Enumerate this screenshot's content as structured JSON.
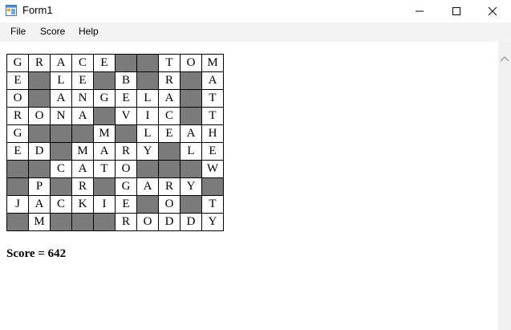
{
  "window": {
    "title": "Form1",
    "icons": {
      "app": "form-app-icon",
      "minimize": "minimize-icon",
      "maximize": "maximize-icon",
      "close": "close-icon",
      "scroll_up": "chevron-up-icon"
    }
  },
  "menu": [
    {
      "label": "File"
    },
    {
      "label": "Score"
    },
    {
      "label": "Help"
    }
  ],
  "grid": {
    "rows": [
      [
        "G",
        "R",
        "A",
        "C",
        "E",
        "#",
        "#",
        "T",
        "O",
        "M"
      ],
      [
        "E",
        "#",
        "L",
        "E",
        "#",
        "B",
        "#",
        "R",
        "#",
        "A"
      ],
      [
        "O",
        "#",
        "A",
        "N",
        "G",
        "E",
        "L",
        "A",
        "#",
        "T"
      ],
      [
        "R",
        "O",
        "N",
        "A",
        "#",
        "V",
        "I",
        "C",
        "#",
        "T"
      ],
      [
        "G",
        "#",
        "#",
        "#",
        "M",
        "#",
        "L",
        "E",
        "A",
        "H"
      ],
      [
        "E",
        "D",
        "#",
        "M",
        "A",
        "R",
        "Y",
        "#",
        "L",
        "E"
      ],
      [
        "#",
        "#",
        "C",
        "A",
        "T",
        "O",
        "#",
        "#",
        "#",
        "W"
      ],
      [
        "#",
        "P",
        "#",
        "R",
        "#",
        "G",
        "A",
        "R",
        "Y",
        "#"
      ],
      [
        "J",
        "A",
        "C",
        "K",
        "I",
        "E",
        "#",
        "O",
        "#",
        "T"
      ],
      [
        "#",
        "M",
        "#",
        "#",
        "#",
        "R",
        "O",
        "D",
        "D",
        "Y"
      ]
    ]
  },
  "score": {
    "text": "Score = 642"
  }
}
